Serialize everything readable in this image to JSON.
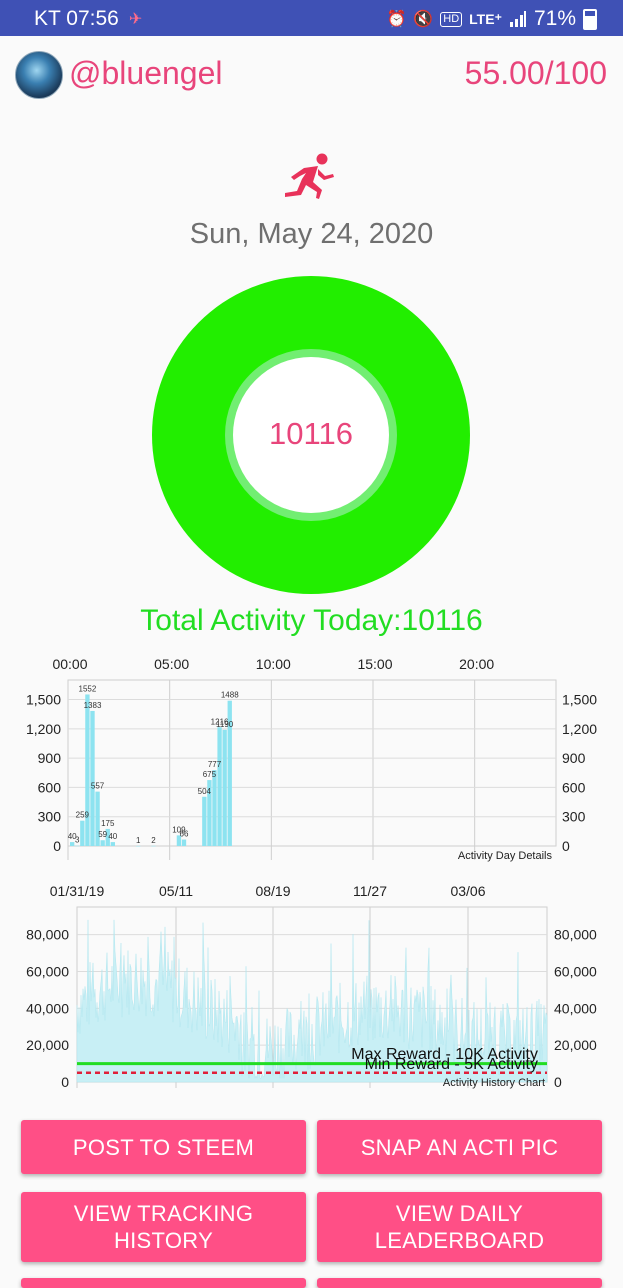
{
  "status_bar": {
    "carrier_time": "KT 07:56",
    "hd_label": "HD",
    "network": "LTE⁺",
    "battery": "71%"
  },
  "header": {
    "username": "@bluengel",
    "score": "55.00/100"
  },
  "date": "Sun, May 24, 2020",
  "ring": {
    "value": "10116",
    "progress_fraction": 1.0,
    "color": "#22ee00"
  },
  "total_label": "Total Activity Today:10116",
  "day_chart": {
    "type": "bar",
    "description": "Activity Day Details",
    "x_ticks": [
      "00:00",
      "05:00",
      "10:00",
      "15:00",
      "20:00"
    ],
    "y_ticks": [
      "0",
      "300",
      "600",
      "900",
      "1,200",
      "1,500"
    ],
    "ylim": [
      0,
      1700
    ],
    "xlim_hours": [
      0,
      24
    ],
    "bar_color": "#8de3f0",
    "bars": [
      {
        "x": 0.0,
        "y": 40,
        "label": "40"
      },
      {
        "x": 0.25,
        "y": 3,
        "label": "3"
      },
      {
        "x": 0.5,
        "y": 259,
        "label": "259"
      },
      {
        "x": 0.75,
        "y": 1552,
        "label": "1552"
      },
      {
        "x": 1.0,
        "y": 1383,
        "label": "1383"
      },
      {
        "x": 1.25,
        "y": 557,
        "label": "557"
      },
      {
        "x": 1.5,
        "y": 59,
        "label": "59"
      },
      {
        "x": 1.75,
        "y": 175,
        "label": "175"
      },
      {
        "x": 2.0,
        "y": 40,
        "label": "40"
      },
      {
        "x": 3.25,
        "y": 1,
        "label": "1"
      },
      {
        "x": 4.0,
        "y": 2,
        "label": "2"
      },
      {
        "x": 5.25,
        "y": 109,
        "label": "109"
      },
      {
        "x": 5.5,
        "y": 66,
        "label": "66"
      },
      {
        "x": 6.5,
        "y": 504,
        "label": "504"
      },
      {
        "x": 6.75,
        "y": 675,
        "label": "675"
      },
      {
        "x": 7.0,
        "y": 777,
        "label": "777"
      },
      {
        "x": 7.25,
        "y": 1216,
        "label": "1216"
      },
      {
        "x": 7.5,
        "y": 1190,
        "label": "1190"
      },
      {
        "x": 7.75,
        "y": 1488,
        "label": "1488"
      }
    ]
  },
  "history_chart": {
    "type": "area",
    "description": "Activity History Chart",
    "x_ticks": [
      "01/31/19",
      "05/11",
      "08/19",
      "11/27",
      "03/06"
    ],
    "y_ticks": [
      "0",
      "20,000",
      "40,000",
      "60,000",
      "80,000"
    ],
    "ylim": [
      0,
      95000
    ],
    "fill_color": "#c8eff5",
    "max_reward": {
      "label": "Max Reward - 10K Activity",
      "value": 10000,
      "color": "#22dd22"
    },
    "min_reward": {
      "label": "Min Reward - 5K Activity",
      "value": 5000,
      "color": "#e0203a"
    }
  },
  "buttons": {
    "post": "POST TO STEEM",
    "snap": "SNAP AN ACTI PIC",
    "tracking": "VIEW TRACKING HISTORY",
    "leaderboard": "VIEW DAILY LEADERBOARD"
  }
}
